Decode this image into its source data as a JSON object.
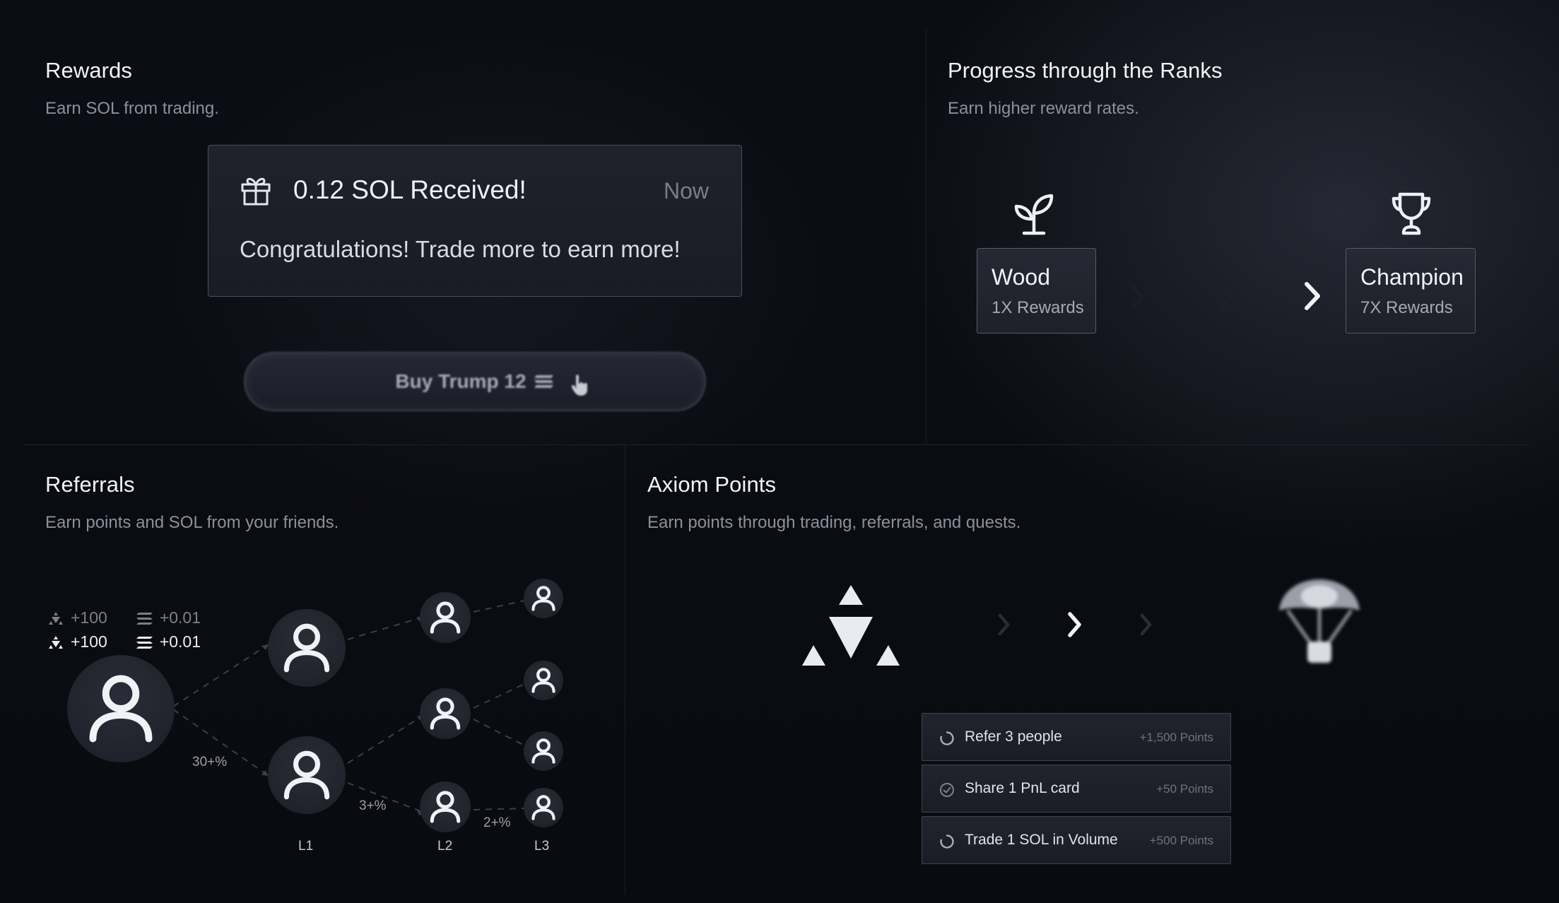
{
  "rewards": {
    "title": "Rewards",
    "subtitle": "Earn SOL from trading.",
    "notification": {
      "title": "0.12 SOL Received!",
      "time": "Now",
      "body": "Congratulations! Trade more to earn more!",
      "icon": "gift-icon"
    },
    "buy_button": {
      "label": "Buy Trump 12",
      "icon": "solana-icon"
    }
  },
  "ranks": {
    "title": "Progress through the Ranks",
    "subtitle": "Earn higher reward rates.",
    "start": {
      "name": "Wood",
      "rewards": "1X Rewards",
      "icon": "sprout-icon"
    },
    "end": {
      "name": "Champion",
      "rewards": "7X Rewards",
      "icon": "trophy-icon"
    }
  },
  "referrals": {
    "title": "Referrals",
    "subtitle": "Earn points and SOL from your friends.",
    "stats": [
      {
        "points": "+100",
        "sol": "+0.01"
      },
      {
        "points": "+100",
        "sol": "+0.01"
      }
    ],
    "levels": [
      "L1",
      "L2",
      "L3"
    ],
    "percents": [
      "30+%",
      "3+%",
      "2+%"
    ]
  },
  "axiom_points": {
    "title": "Axiom Points",
    "subtitle": "Earn points through trading, referrals, and quests.",
    "quests": [
      {
        "label": "Refer 3 people",
        "points": "+1,500 Points",
        "status": "in-progress"
      },
      {
        "label": "Share 1 PnL card",
        "points": "+50 Points",
        "status": "done"
      },
      {
        "label": "Trade 1 SOL in Volume",
        "points": "+500 Points",
        "status": "in-progress"
      }
    ]
  },
  "colors": {
    "background": "#0b0c12",
    "card": "#1f2029",
    "border": "#575968",
    "text": "#f1f2f6",
    "muted": "#8d8f9c"
  }
}
